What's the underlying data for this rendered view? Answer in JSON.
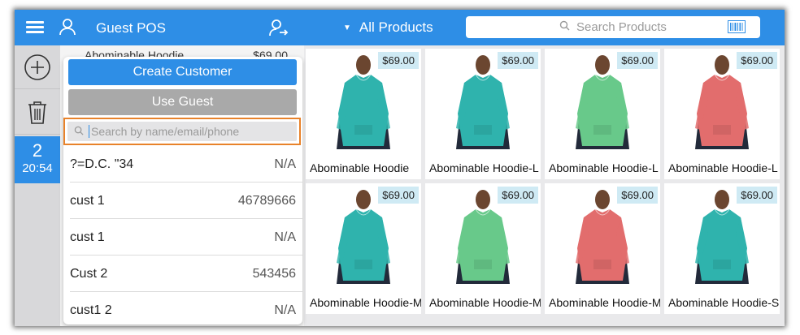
{
  "header": {
    "title": "Guest POS",
    "category": "All Products",
    "search_placeholder": "Search Products",
    "accent": "#2e8ee6"
  },
  "rail": {
    "order_number": "2",
    "order_time": "20:54"
  },
  "cart_peek": {
    "item": "Abominable Hoodie",
    "price": "$69.00"
  },
  "popup": {
    "create_label": "Create Customer",
    "guest_label": "Use Guest",
    "search_placeholder": "Search by name/email/phone",
    "customers": [
      {
        "name": "?=D.C. \"34",
        "value": "N/A"
      },
      {
        "name": "cust 1",
        "value": "46789666"
      },
      {
        "name": "cust 1",
        "value": "N/A"
      },
      {
        "name": "Cust 2",
        "value": "543456"
      },
      {
        "name": "cust1 2",
        "value": "N/A"
      }
    ]
  },
  "products": [
    {
      "name": "Abominable Hoodie",
      "price": "$69.00",
      "color": "#2fb3ad"
    },
    {
      "name": "Abominable Hoodie-L",
      "price": "$69.00",
      "color": "#2fb3ad"
    },
    {
      "name": "Abominable Hoodie-L",
      "price": "$69.00",
      "color": "#68c98a"
    },
    {
      "name": "Abominable Hoodie-L",
      "price": "$69.00",
      "color": "#e26d6d"
    },
    {
      "name": "Abominable Hoodie-M",
      "price": "$69.00",
      "color": "#2fb3ad"
    },
    {
      "name": "Abominable Hoodie-M",
      "price": "$69.00",
      "color": "#68c98a"
    },
    {
      "name": "Abominable Hoodie-M",
      "price": "$69.00",
      "color": "#e26d6d"
    },
    {
      "name": "Abominable Hoodie-S",
      "price": "$69.00",
      "color": "#2fb3ad"
    }
  ]
}
